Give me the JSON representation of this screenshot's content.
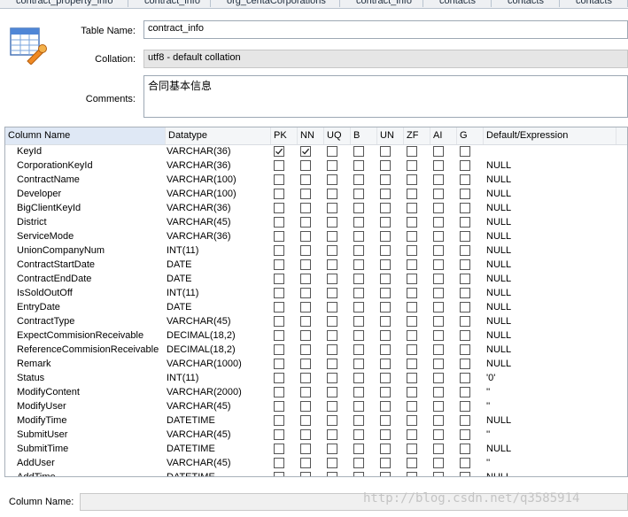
{
  "tabs": [
    "contract_property_info",
    "contract_info",
    "org_centaCorporations",
    "contract_info",
    "contacts",
    "contacts",
    "contacts"
  ],
  "form": {
    "table_name_label": "Table Name:",
    "table_name_value": "contract_info",
    "collation_label": "Collation:",
    "collation_value": "utf8 - default collation",
    "comments_label": "Comments:",
    "comments_value": "合同基本信息"
  },
  "grid": {
    "headers": [
      "Column Name",
      "Datatype",
      "PK",
      "NN",
      "UQ",
      "B",
      "UN",
      "ZF",
      "AI",
      "G",
      "Default/Expression"
    ],
    "rows": [
      {
        "name": "KeyId",
        "type": "VARCHAR(36)",
        "pk": true,
        "nn": true,
        "default": ""
      },
      {
        "name": "CorporationKeyId",
        "type": "VARCHAR(36)",
        "pk": false,
        "nn": false,
        "default": "NULL"
      },
      {
        "name": "ContractName",
        "type": "VARCHAR(100)",
        "pk": false,
        "nn": false,
        "default": "NULL"
      },
      {
        "name": "Developer",
        "type": "VARCHAR(100)",
        "pk": false,
        "nn": false,
        "default": "NULL"
      },
      {
        "name": "BigClientKeyId",
        "type": "VARCHAR(36)",
        "pk": false,
        "nn": false,
        "default": "NULL"
      },
      {
        "name": "District",
        "type": "VARCHAR(45)",
        "pk": false,
        "nn": false,
        "default": "NULL"
      },
      {
        "name": "ServiceMode",
        "type": "VARCHAR(36)",
        "pk": false,
        "nn": false,
        "default": "NULL"
      },
      {
        "name": "UnionCompanyNum",
        "type": "INT(11)",
        "pk": false,
        "nn": false,
        "default": "NULL"
      },
      {
        "name": "ContractStartDate",
        "type": "DATE",
        "pk": false,
        "nn": false,
        "default": "NULL"
      },
      {
        "name": "ContractEndDate",
        "type": "DATE",
        "pk": false,
        "nn": false,
        "default": "NULL"
      },
      {
        "name": "IsSoldOutOff",
        "type": "INT(11)",
        "pk": false,
        "nn": false,
        "default": "NULL"
      },
      {
        "name": "EntryDate",
        "type": "DATE",
        "pk": false,
        "nn": false,
        "default": "NULL"
      },
      {
        "name": "ContractType",
        "type": "VARCHAR(45)",
        "pk": false,
        "nn": false,
        "default": "NULL"
      },
      {
        "name": "ExpectCommisionReceivable",
        "type": "DECIMAL(18,2)",
        "pk": false,
        "nn": false,
        "default": "NULL"
      },
      {
        "name": "ReferenceCommisionReceivable",
        "type": "DECIMAL(18,2)",
        "pk": false,
        "nn": false,
        "default": "NULL"
      },
      {
        "name": "Remark",
        "type": "VARCHAR(1000)",
        "pk": false,
        "nn": false,
        "default": "NULL"
      },
      {
        "name": "Status",
        "type": "INT(11)",
        "pk": false,
        "nn": false,
        "default": "'0'"
      },
      {
        "name": "ModifyContent",
        "type": "VARCHAR(2000)",
        "pk": false,
        "nn": false,
        "default": "''"
      },
      {
        "name": "ModifyUser",
        "type": "VARCHAR(45)",
        "pk": false,
        "nn": false,
        "default": "''"
      },
      {
        "name": "ModifyTime",
        "type": "DATETIME",
        "pk": false,
        "nn": false,
        "default": "NULL"
      },
      {
        "name": "SubmitUser",
        "type": "VARCHAR(45)",
        "pk": false,
        "nn": false,
        "default": "''"
      },
      {
        "name": "SubmitTime",
        "type": "DATETIME",
        "pk": false,
        "nn": false,
        "default": "NULL"
      },
      {
        "name": "AddUser",
        "type": "VARCHAR(45)",
        "pk": false,
        "nn": false,
        "default": "''"
      },
      {
        "name": "AddTime",
        "type": "DATETIME",
        "pk": false,
        "nn": false,
        "default": "NULL"
      }
    ]
  },
  "footer": {
    "column_name_label": "Column Name:",
    "column_name_value": ""
  },
  "watermark": "http://blog.csdn.net/q3585914",
  "icons": {
    "table": "table-edit-icon",
    "check": "check-icon"
  },
  "colors": {
    "header_bg": "#f4f6f8",
    "selected_header": "#dfe8f5",
    "gray_field": "#e6e6e6"
  }
}
